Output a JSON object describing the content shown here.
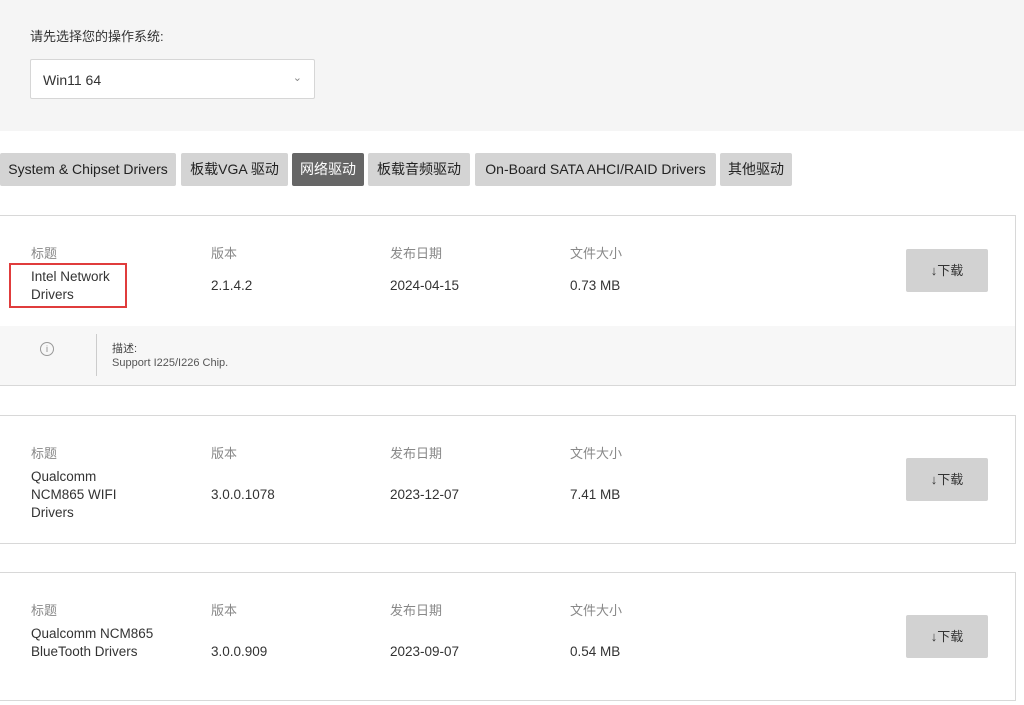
{
  "os": {
    "label": "请先选择您的操作系统:",
    "selected": "Win11 64"
  },
  "tabs": [
    {
      "label": "System & Chipset Drivers"
    },
    {
      "label": "板载VGA 驱动"
    },
    {
      "label": "网络驱动",
      "active": true
    },
    {
      "label": "板载音频驱动"
    },
    {
      "label": "On-Board SATA AHCI/RAID Drivers"
    },
    {
      "label": "其他驱动"
    }
  ],
  "headers": {
    "title": "标题",
    "version": "版本",
    "date": "发布日期",
    "size": "文件大小"
  },
  "download_label": "↓下载",
  "drivers": [
    {
      "title": "Intel Network Drivers",
      "version": "2.1.4.2",
      "date": "2024-04-15",
      "size": "0.73 MB",
      "desc_label": "描述:",
      "desc": "Support I225/I226 Chip."
    },
    {
      "title": "Qualcomm NCM865 WIFI Drivers",
      "version": "3.0.0.1078",
      "date": "2023-12-07",
      "size": "7.41 MB"
    },
    {
      "title": "Qualcomm NCM865 BlueTooth Drivers",
      "version": "3.0.0.909",
      "date": "2023-09-07",
      "size": "0.54 MB"
    }
  ]
}
